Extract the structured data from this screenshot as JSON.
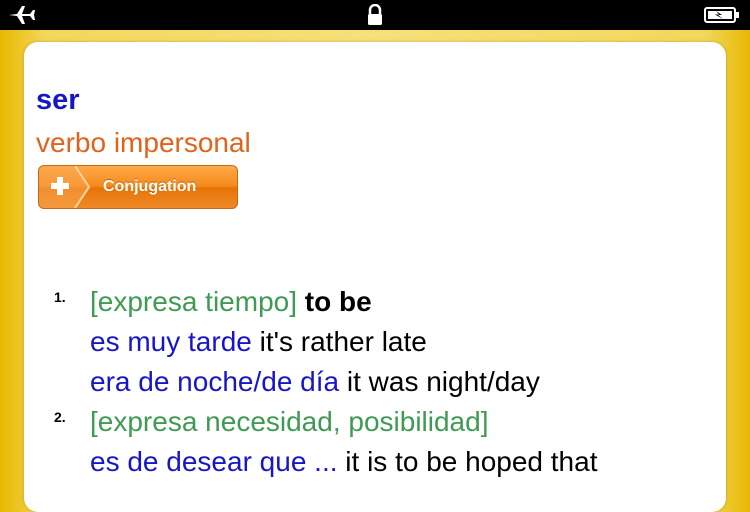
{
  "status_bar": {
    "icons": [
      "airplane-icon",
      "lock-icon",
      "battery-icon"
    ]
  },
  "entry": {
    "headword": "ser",
    "part_of_speech": "verbo impersonal",
    "conjugation_button": "Conjugation",
    "senses": [
      {
        "number": "1.",
        "context": "[expresa tiempo]",
        "translation": "to be",
        "examples": [
          {
            "es": "es muy tarde",
            "en": "it's rather late"
          },
          {
            "es": "era de noche/de día",
            "en": "it was night/day"
          }
        ]
      },
      {
        "number": "2.",
        "context": "[expresa necesidad, posibilidad]",
        "translation": "",
        "examples": [
          {
            "es": "es de desear que ...",
            "en": "it is to be hoped that"
          }
        ]
      }
    ]
  },
  "colors": {
    "headword": "#1616c8",
    "part_of_speech": "#e2621a",
    "context": "#3f9a54",
    "example_spanish": "#1616c8",
    "button": "#f58a1c",
    "background": "#f7e07a"
  }
}
